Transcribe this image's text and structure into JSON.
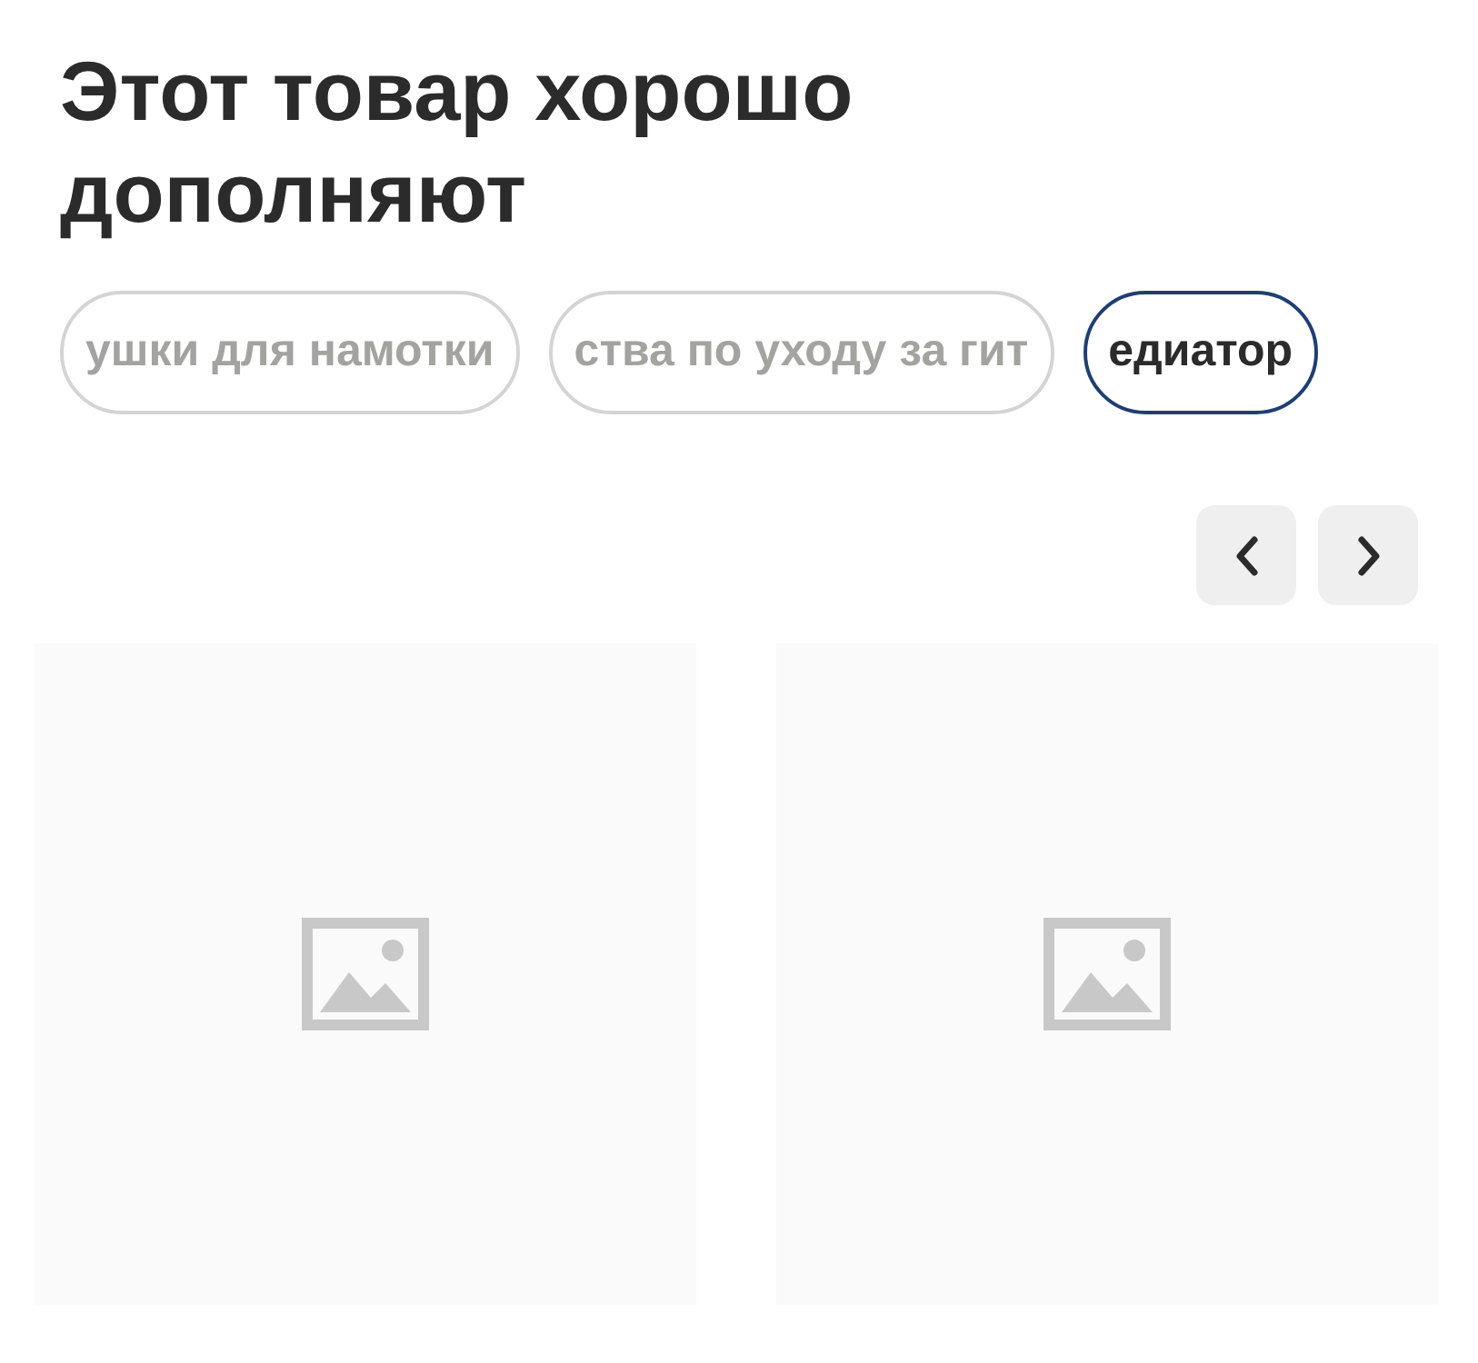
{
  "title": "Этот товар хорошо дополняют",
  "chips": [
    {
      "label": "ушки для намотки",
      "selected": false
    },
    {
      "label": "ства по уходу за гит",
      "selected": false
    },
    {
      "label": "едиатор",
      "selected": true
    }
  ],
  "products": [
    {
      "kind": "placeholder"
    },
    {
      "kind": "placeholder"
    }
  ]
}
